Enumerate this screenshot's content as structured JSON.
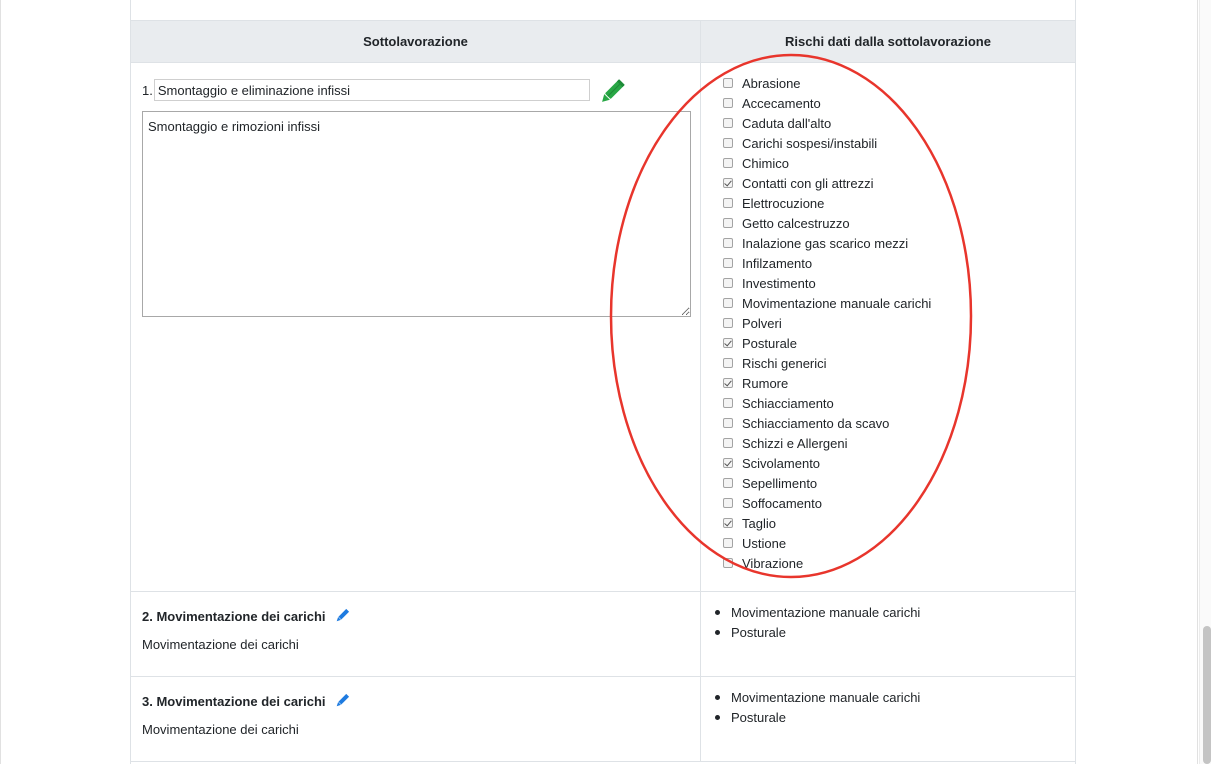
{
  "table": {
    "headers": [
      "Sottolavorazione",
      "Rischi dati dalla sottolavorazione"
    ]
  },
  "sub1": {
    "number": "1.",
    "name_value": "Smontaggio e eliminazione infissi",
    "description_value": "Smontaggio e rimozioni infissi",
    "risks": [
      {
        "label": "Abrasione",
        "checked": false
      },
      {
        "label": "Accecamento",
        "checked": false
      },
      {
        "label": "Caduta dall'alto",
        "checked": false
      },
      {
        "label": "Carichi sospesi/instabili",
        "checked": false
      },
      {
        "label": "Chimico",
        "checked": false
      },
      {
        "label": "Contatti con gli attrezzi",
        "checked": true
      },
      {
        "label": "Elettrocuzione",
        "checked": false
      },
      {
        "label": "Getto calcestruzzo",
        "checked": false
      },
      {
        "label": "Inalazione gas scarico mezzi",
        "checked": false
      },
      {
        "label": "Infilzamento",
        "checked": false
      },
      {
        "label": "Investimento",
        "checked": false
      },
      {
        "label": "Movimentazione manuale carichi",
        "checked": false
      },
      {
        "label": "Polveri",
        "checked": false
      },
      {
        "label": "Posturale",
        "checked": true
      },
      {
        "label": "Rischi generici",
        "checked": false
      },
      {
        "label": "Rumore",
        "checked": true
      },
      {
        "label": "Schiacciamento",
        "checked": false
      },
      {
        "label": "Schiacciamento da scavo",
        "checked": false
      },
      {
        "label": "Schizzi e Allergeni",
        "checked": false
      },
      {
        "label": "Scivolamento",
        "checked": true
      },
      {
        "label": "Sepellimento",
        "checked": false
      },
      {
        "label": "Soffocamento",
        "checked": false
      },
      {
        "label": "Taglio",
        "checked": true
      },
      {
        "label": "Ustione",
        "checked": false
      },
      {
        "label": "Vibrazione",
        "checked": false
      }
    ]
  },
  "sub2": {
    "title": "2. Movimentazione dei carichi",
    "description": "Movimentazione dei carichi",
    "risks": [
      "Movimentazione manuale carichi",
      "Posturale"
    ]
  },
  "sub3": {
    "title": "3. Movimentazione dei carichi",
    "description": "Movimentazione dei carichi",
    "risks": [
      "Movimentazione manuale carichi",
      "Posturale"
    ]
  },
  "colors": {
    "annotation": "#e8352c",
    "edit_green": "#28a745",
    "edit_blue": "#1e7be0",
    "header_bg": "#e9ecef"
  },
  "icons": {
    "sub1_edit": "pencil-icon",
    "row_edit": "pencil-icon"
  }
}
